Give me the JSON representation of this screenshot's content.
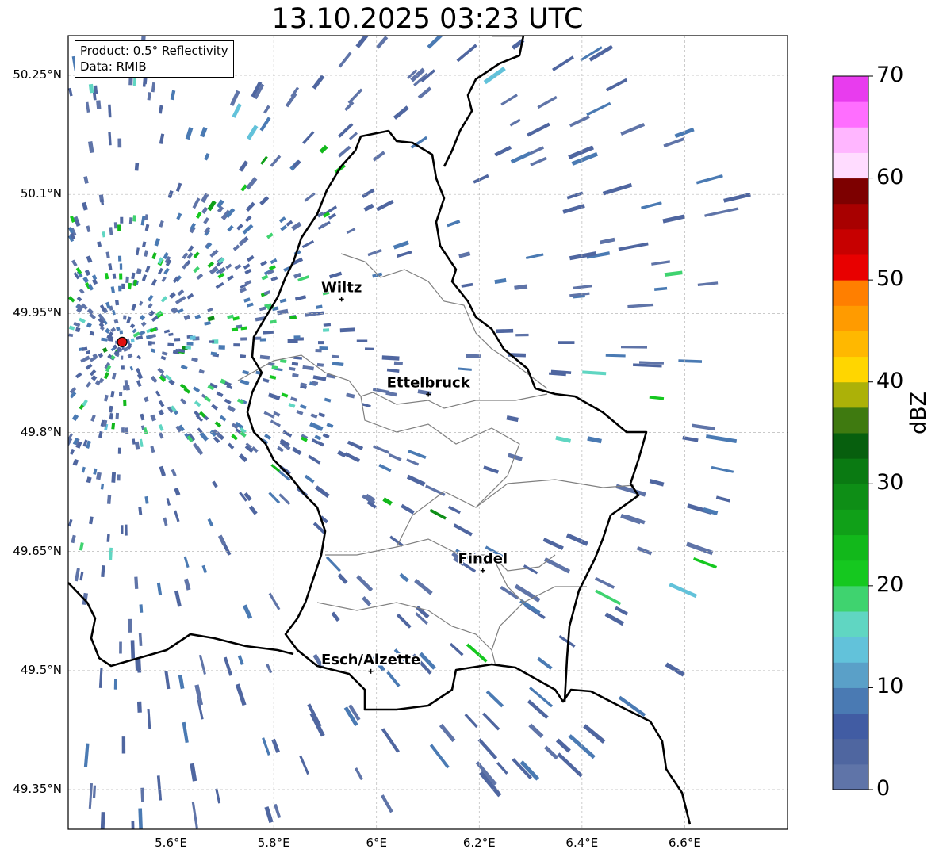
{
  "title": "13.10.2025 03:23 UTC",
  "info": {
    "product": "Product: 0.5° Reflectivity",
    "source": "Data: RMIB"
  },
  "map": {
    "lon_range": [
      5.4,
      6.8
    ],
    "lat_range": [
      49.3,
      50.3
    ],
    "x_ticks": [
      "5.6°E",
      "5.8°E",
      "6°E",
      "6.2°E",
      "6.4°E",
      "6.6°E"
    ],
    "y_ticks": [
      "50.25°N",
      "50.1°N",
      "49.95°N",
      "49.8°N",
      "49.65°N",
      "49.5°N",
      "49.35°N"
    ],
    "radar_site": {
      "lon": 5.505,
      "lat": 49.914
    },
    "cities": [
      {
        "name": "Wiltz",
        "lon": 5.932,
        "lat": 49.968
      },
      {
        "name": "Ettelbruck",
        "lon": 6.101,
        "lat": 49.848
      },
      {
        "name": "Findel",
        "lon": 6.207,
        "lat": 49.626
      },
      {
        "name": "Esch/Alzette",
        "lon": 5.989,
        "lat": 49.499
      }
    ]
  },
  "colorbar": {
    "unit": "dBZ",
    "min": 0,
    "max": 70,
    "ticks": [
      "0",
      "10",
      "20",
      "30",
      "40",
      "50",
      "60",
      "70"
    ],
    "colors": [
      "#5f74a8",
      "#4f66a0",
      "#415ca3",
      "#4a7ab3",
      "#5aa0c8",
      "#62c2da",
      "#60d6c2",
      "#3fd36f",
      "#15c81f",
      "#12b81b",
      "#10a018",
      "#0e8e16",
      "#0a7a12",
      "#075f0e",
      "#3f7a10",
      "#acb108",
      "#ffd600",
      "#ffb800",
      "#ff9b00",
      "#ff7f00",
      "#e80000",
      "#c70000",
      "#a80000",
      "#7d0000",
      "#ffdcff",
      "#ffb6ff",
      "#ff6eff",
      "#e83cee"
    ]
  }
}
